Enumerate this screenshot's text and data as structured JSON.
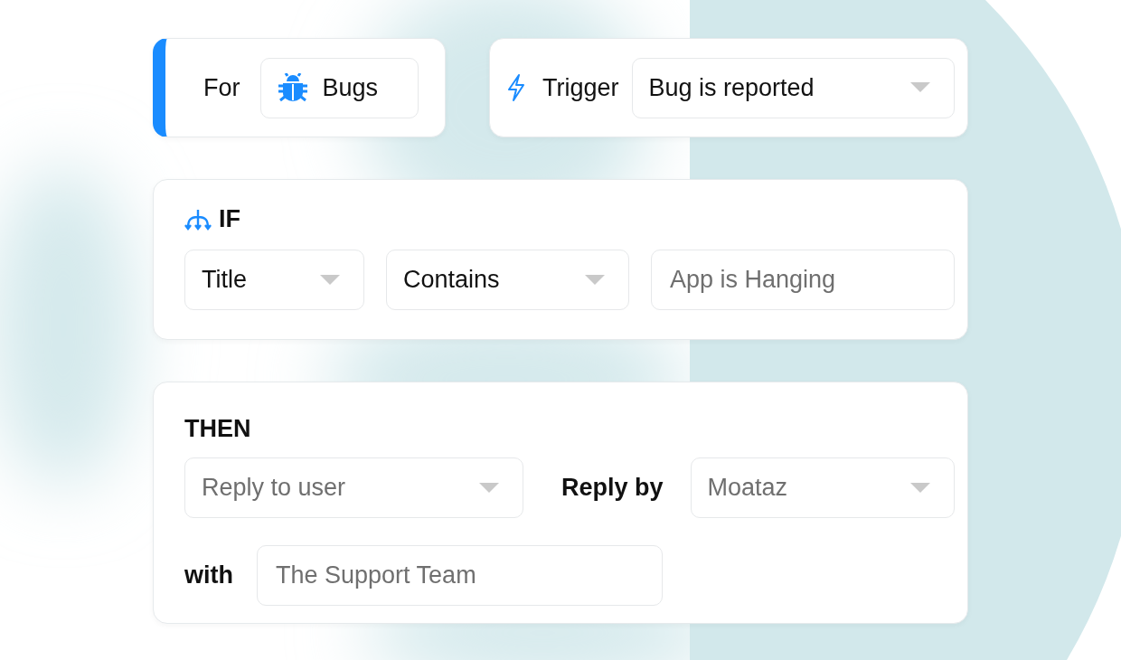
{
  "for_card": {
    "label": "For",
    "chip": "Bugs"
  },
  "trigger_card": {
    "label": "Trigger",
    "dropdown": {
      "value": "Bug is reported"
    }
  },
  "if_card": {
    "title": "IF",
    "fields": [
      {
        "kind": "dropdown",
        "value": "Title"
      },
      {
        "kind": "dropdown",
        "value": "Contains"
      },
      {
        "kind": "input",
        "placeholder": "App is Hanging"
      }
    ]
  },
  "then_card": {
    "title": "THEN",
    "action": {
      "placeholder": "Reply to user"
    },
    "reply_by_label": "Reply by",
    "reply_by": {
      "placeholder": "Moataz"
    },
    "with_label": "with",
    "with_field": {
      "placeholder": "The Support Team"
    }
  }
}
